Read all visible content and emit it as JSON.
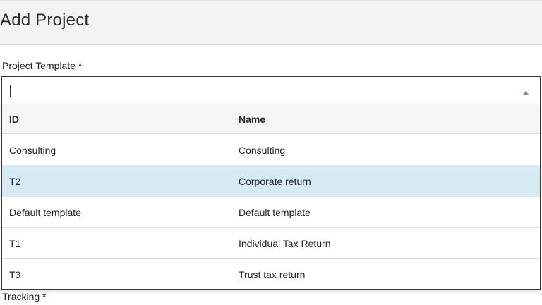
{
  "header": {
    "title": "Add Project"
  },
  "project_template": {
    "label": "Project Template *",
    "value": "",
    "placeholder": "",
    "arrow_icon": "triangle-up-icon"
  },
  "dropdown": {
    "columns": {
      "id": "ID",
      "name": "Name"
    },
    "rows": [
      {
        "id": "Consulting",
        "name": "Consulting",
        "selected": false
      },
      {
        "id": "T2",
        "name": "Corporate return",
        "selected": true
      },
      {
        "id": "Default template",
        "name": "Default template",
        "selected": false
      },
      {
        "id": "T1",
        "name": "Individual Tax Return",
        "selected": false
      },
      {
        "id": "T3",
        "name": "Trust tax return",
        "selected": false
      }
    ],
    "highlight_color": "#d6eaf3"
  },
  "tracking": {
    "label": "Tracking *"
  }
}
